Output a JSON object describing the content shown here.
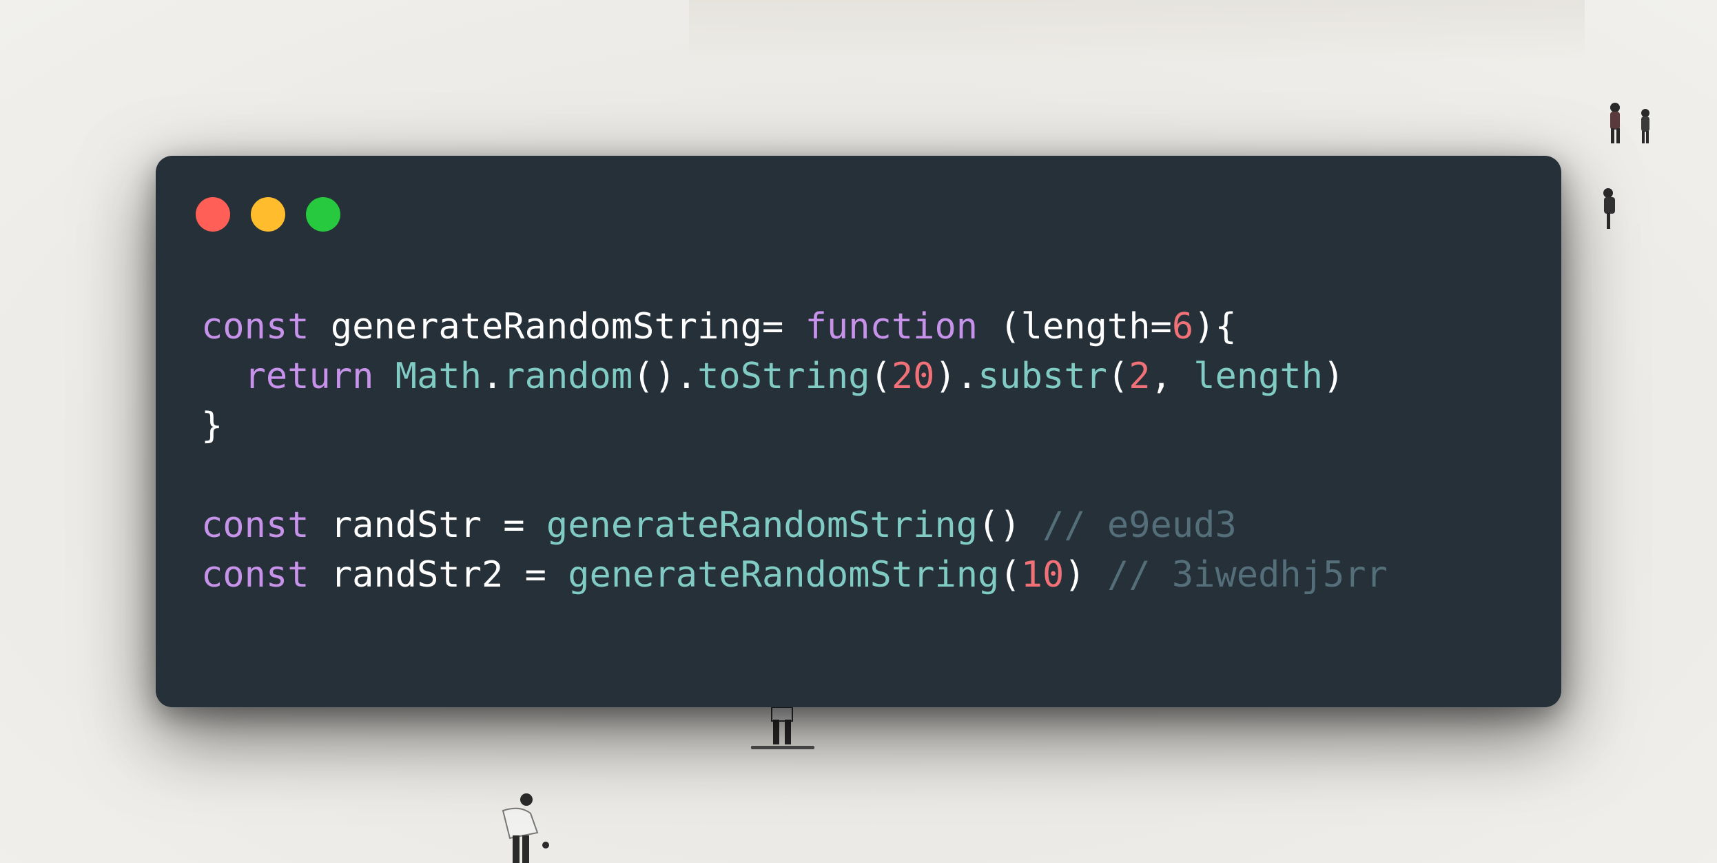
{
  "colors": {
    "window_bg": "#263038",
    "keyword": "#c792ea",
    "function": "#80cbc4",
    "number": "#f07178",
    "comment": "#546e7a",
    "plain": "#ffffff"
  },
  "window_controls": [
    "close-dot",
    "minimize-dot",
    "maximize-dot"
  ],
  "code": {
    "line1": {
      "kw": "const",
      "name": " generateRandomString= ",
      "kw2": "function",
      "p1": " (length=",
      "num": "6",
      "p2": "){"
    },
    "line2": {
      "indent": "  ",
      "kw": "return",
      "sp": " ",
      "obj": "Math",
      "dot1": ".",
      "m1": "random",
      "p1": "().",
      "m2": "toString",
      "p2": "(",
      "num1": "20",
      "p3": ").",
      "m3": "substr",
      "p4": "(",
      "num2": "2",
      "p5": ", ",
      "arg": "length",
      "p6": ")"
    },
    "line3": {
      "brace": "}"
    },
    "line5": {
      "kw": "const",
      "p1": " randStr = ",
      "call": "generateRandomString",
      "p2": "() ",
      "comment": "// e9eud3"
    },
    "line6": {
      "kw": "const",
      "p1": " randStr2 = ",
      "call": "generateRandomString",
      "p2": "(",
      "num": "10",
      "p3": ") ",
      "comment": "// 3iwedhj5rr"
    }
  }
}
